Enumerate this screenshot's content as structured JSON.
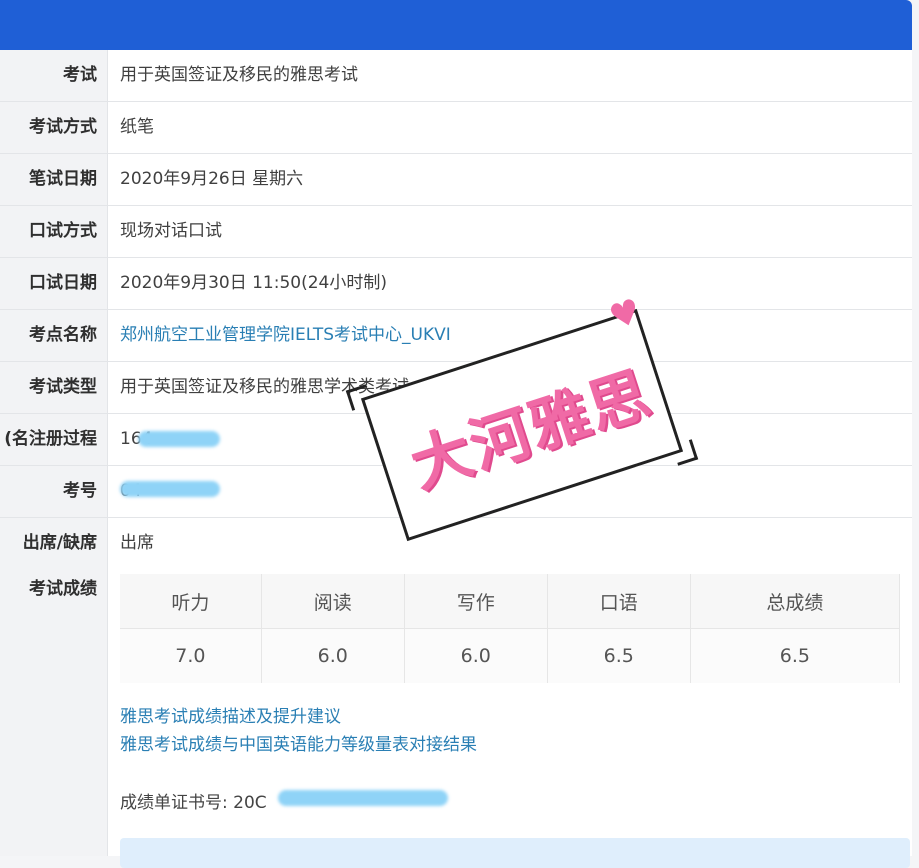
{
  "rows": [
    {
      "label": "考试",
      "value": "用于英国签证及移民的雅思考试"
    },
    {
      "label": "考试方式",
      "value": "纸笔"
    },
    {
      "label": "笔试日期",
      "value": "2020年9月26日 星期六"
    },
    {
      "label": "口试方式",
      "value": "现场对话口试"
    },
    {
      "label": "口试日期",
      "value": "2020年9月30日 11:50(24小时制)"
    },
    {
      "label": "考点名称",
      "value": "郑州航空工业管理学院IELTS考试中心_UKVI"
    },
    {
      "label": "考试类型",
      "value": "用于英国签证及移民的雅思学术类考试"
    },
    {
      "label": "名注册过程)",
      "value": "164"
    },
    {
      "label": "考号",
      "value": "04"
    },
    {
      "label": "出席/缺席",
      "value": "出席"
    }
  ],
  "scores": {
    "label": "考试成绩",
    "headers": [
      "听力",
      "阅读",
      "写作",
      "口语",
      "总成绩"
    ],
    "values": [
      "7.0",
      "6.0",
      "6.0",
      "6.5",
      "6.5"
    ]
  },
  "links": {
    "desc": "雅思考试成绩描述及提升建议",
    "cse": "雅思考试成绩与中国英语能力等级量表对接结果"
  },
  "cert": {
    "label": "成绩单证书号: 20C"
  },
  "stamp": {
    "text": "大河雅思"
  },
  "colors": {
    "accent": "#1f5fd6",
    "link": "#2a7fb4",
    "stamp": "#f06aa6"
  }
}
